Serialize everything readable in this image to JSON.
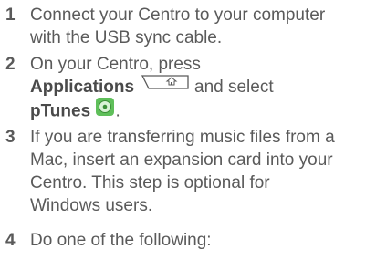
{
  "steps": [
    {
      "number": "1",
      "line1": "Connect your Centro to your computer",
      "line2": "with the USB sync cable."
    },
    {
      "number": "2",
      "line1": "On your Centro, press",
      "key_name": "Applications",
      "key_icon": "home-icon",
      "after_key": "and select",
      "app_name": "pTunes",
      "app_icon": "ptunes-icon",
      "after_app": "."
    },
    {
      "number": "3",
      "line1": "If you are transferring music files from a",
      "line2": "Mac, insert an expansion card into your",
      "line3": "Centro. This step is optional for",
      "line4": "Windows users."
    },
    {
      "number": "4",
      "line1": "Do one of the following:"
    }
  ],
  "colors": {
    "text": "#5a5a5a",
    "ptunes_green": "#4caf50"
  }
}
